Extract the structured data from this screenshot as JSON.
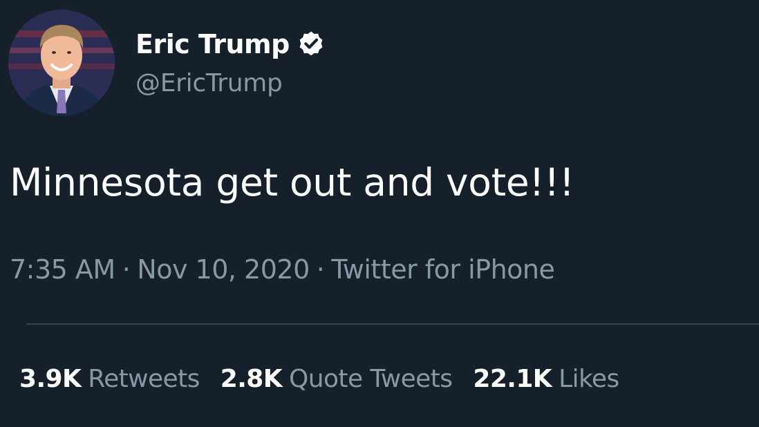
{
  "author": {
    "display_name": "Eric Trump",
    "handle": "@EricTrump",
    "verified": true,
    "avatar_icon": "profile-photo"
  },
  "tweet": {
    "text": "Minnesota get out and vote!!!",
    "time": "7:35 AM",
    "date": "Nov 10, 2020",
    "source": "Twitter for iPhone",
    "separator": "·"
  },
  "stats": {
    "retweets": {
      "count": "3.9K",
      "label": "Retweets"
    },
    "quote_tweets": {
      "count": "2.8K",
      "label": "Quote Tweets"
    },
    "likes": {
      "count": "22.1K",
      "label": "Likes"
    }
  },
  "colors": {
    "background": "#15202b",
    "primary_text": "#ffffff",
    "secondary_text": "#8899a6",
    "divider": "#38444d"
  }
}
